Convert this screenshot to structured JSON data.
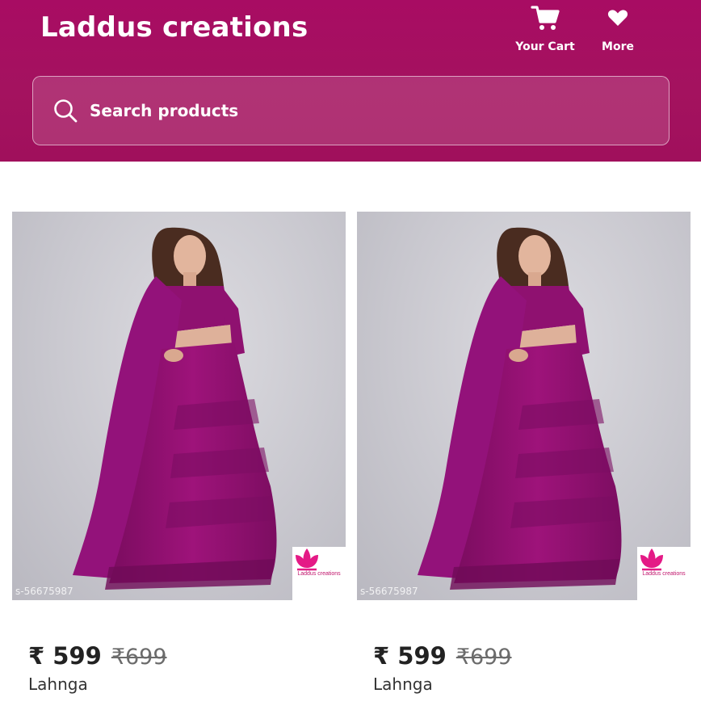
{
  "header": {
    "brand": "Laddus creations",
    "cart": {
      "label": "Your Cart",
      "icon": "cart-icon"
    },
    "more": {
      "label": "More",
      "icon": "heart-icon"
    }
  },
  "search": {
    "placeholder": "Search products",
    "value": "",
    "icon": "search-icon"
  },
  "colors": {
    "header_bg": "#a80c63",
    "accent": "#c0156c",
    "product": "#8e1170"
  },
  "products": [
    {
      "image": "lehenga-photo",
      "sku_watermark": "s-56675987",
      "price_current": "₹ 599",
      "price_original": "₹699",
      "name": "Lahnga",
      "badge_text": "Laddus creations"
    },
    {
      "image": "lehenga-photo",
      "sku_watermark": "s-56675987",
      "price_current": "₹ 599",
      "price_original": "₹699",
      "name": "Lahnga",
      "badge_text": "Laddus creations"
    }
  ]
}
